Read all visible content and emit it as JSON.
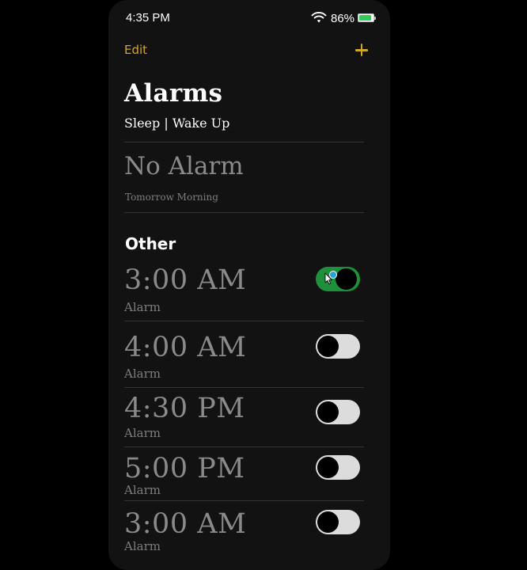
{
  "status_bar": {
    "time": "4:35 PM",
    "battery_percent": "86%",
    "battery_level": 0.86,
    "wifi_icon": "wifi-icon",
    "battery_icon": "battery-icon"
  },
  "nav": {
    "edit_label": "Edit",
    "add_icon": "plus-icon"
  },
  "header": {
    "title": "Alarms",
    "subtitle": "Sleep | Wake Up"
  },
  "sleep": {
    "status": "No Alarm",
    "schedule": "Tomorrow Morning"
  },
  "other": {
    "title": "Other",
    "alarms": [
      {
        "time": "3:00 AM",
        "label": "Alarm",
        "enabled": true
      },
      {
        "time": "4:00 AM",
        "label": "Alarm",
        "enabled": false
      },
      {
        "time": "4:30 PM",
        "label": "Alarm",
        "enabled": false
      },
      {
        "time": "5:00 PM",
        "label": "Alarm",
        "enabled": false
      },
      {
        "time": "3:00 AM",
        "label": "Alarm",
        "enabled": false
      }
    ]
  },
  "colors": {
    "accent": "#d1a629",
    "toggle_on": "#1e8f3a",
    "background": "#121212"
  }
}
